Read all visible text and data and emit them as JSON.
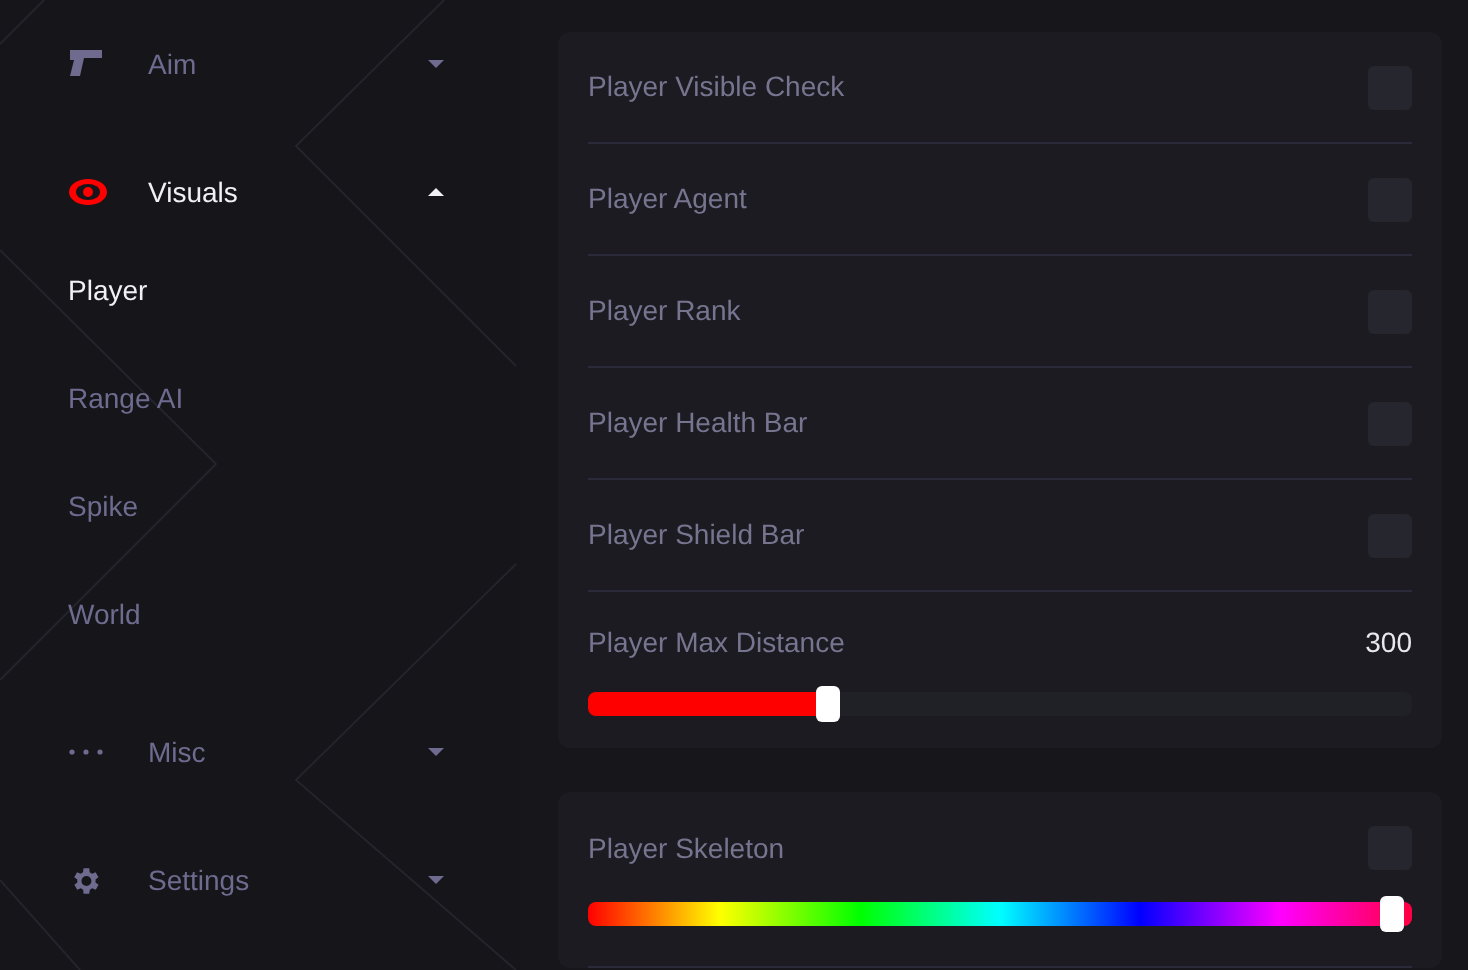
{
  "sidebar": {
    "items": [
      {
        "kind": "section",
        "label": "Aim",
        "expanded": false,
        "selected": false
      },
      {
        "kind": "section",
        "label": "Visuals",
        "expanded": true,
        "selected": true,
        "children": [
          {
            "label": "Player",
            "selected": true
          },
          {
            "label": "Range AI",
            "selected": false
          },
          {
            "label": "Spike",
            "selected": false
          },
          {
            "label": "World",
            "selected": false
          }
        ]
      },
      {
        "kind": "section",
        "label": "Misc",
        "expanded": false,
        "selected": false
      },
      {
        "kind": "section",
        "label": "Settings",
        "expanded": false,
        "selected": false
      }
    ]
  },
  "panels": [
    {
      "rows": [
        {
          "kind": "toggle",
          "label": "Player Visible Check",
          "checked": false
        },
        {
          "kind": "toggle",
          "label": "Player Agent",
          "checked": false
        },
        {
          "kind": "toggle",
          "label": "Player Rank",
          "checked": false
        },
        {
          "kind": "toggle",
          "label": "Player Health Bar",
          "checked": false
        },
        {
          "kind": "toggle",
          "label": "Player Shield Bar",
          "checked": false
        },
        {
          "kind": "slider",
          "label": "Player Max Distance",
          "reading": "300",
          "level": 0.285
        }
      ]
    },
    {
      "rows": [
        {
          "kind": "color",
          "label": "Player Skeleton",
          "checked": false,
          "level": 0.99
        }
      ]
    }
  ]
}
